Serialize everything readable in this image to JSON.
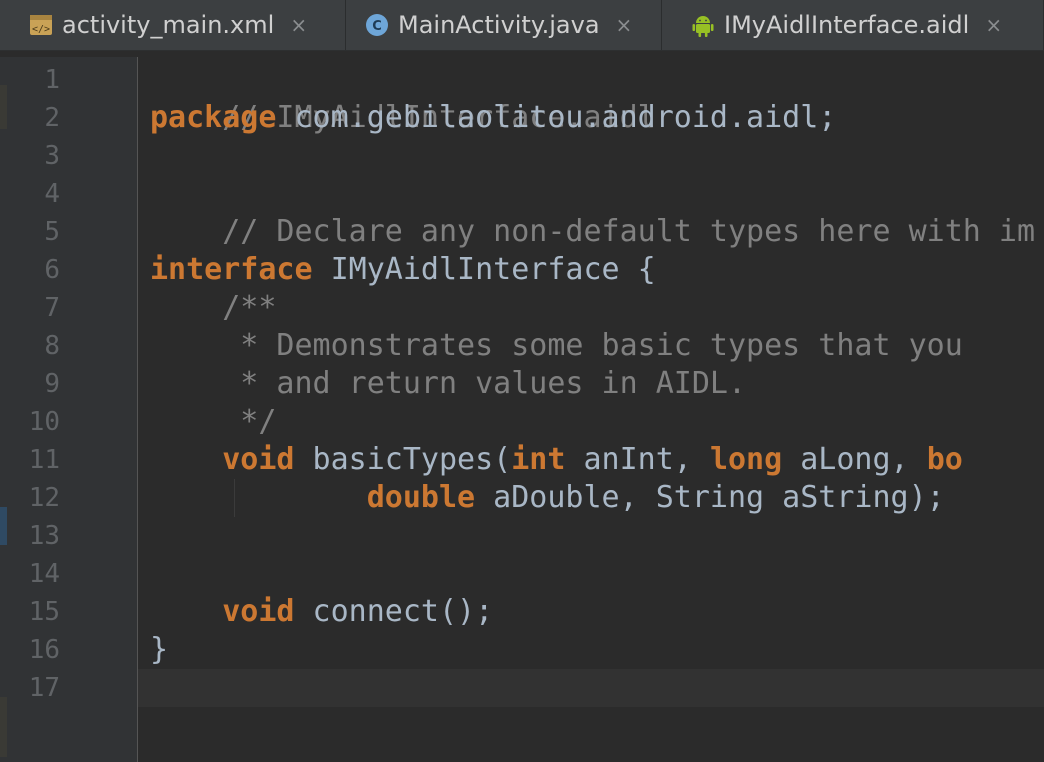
{
  "tabs": [
    {
      "label": "activity_main.xml",
      "icon": "xml-file-icon",
      "close": "×"
    },
    {
      "label": "MainActivity.java",
      "icon": "java-class-icon",
      "close": "×"
    },
    {
      "label": "IMyAidlInterface.aidl",
      "icon": "android-icon",
      "close": "×"
    }
  ],
  "colors": {
    "keyword": "#cc7832",
    "comment": "#808080",
    "text": "#a9b7c6",
    "gutter_bg": "#313335",
    "editor_bg": "#2b2b2b",
    "current_line_bg": "#323232"
  },
  "line_numbers": [
    "1",
    "2",
    "3",
    "4",
    "5",
    "6",
    "7",
    "8",
    "9",
    "10",
    "11",
    "12",
    "13",
    "14",
    "15",
    "16",
    "17"
  ],
  "code": {
    "l1": "// IMyAidlInterface.aidl",
    "l2_kw": "package",
    "l2_rest": " com.gebilaolitou.android.aidl;",
    "l4": "// Declare any non-default types here with im",
    "l6_kw": "interface",
    "l6_rest": " IMyAidlInterface {",
    "l7": "    /**",
    "l8": "     * Demonstrates some basic types that you",
    "l9": "     * and return values in AIDL.",
    "l10": "     */",
    "l11_indent": "    ",
    "l11_kw1": "void",
    "l11_mid1": " basicTypes(",
    "l11_kw2": "int",
    "l11_mid2": " anInt, ",
    "l11_kw3": "long",
    "l11_mid3": " aLong, ",
    "l11_kw4": "bo",
    "l12_indent": "            ",
    "l12_kw": "double",
    "l12_mid": " aDouble, ",
    "l12_type": "String",
    "l12_rest": " aString);",
    "l15_indent": "    ",
    "l15_kw": "void",
    "l15_rest": " connect();",
    "l16": "}"
  }
}
